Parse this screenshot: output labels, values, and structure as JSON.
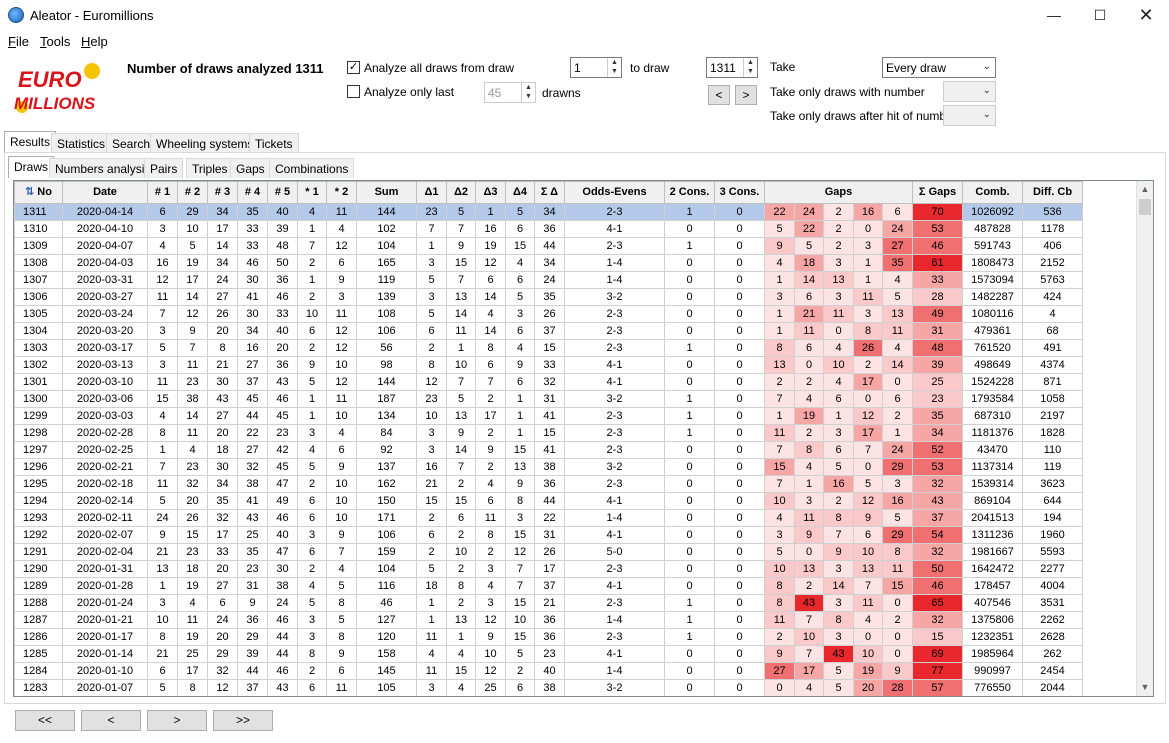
{
  "window": {
    "title": "Aleator - Euromillions"
  },
  "menu": [
    "File",
    "Tools",
    "Help"
  ],
  "controls": {
    "draws_analyzed": "Number of draws analyzed 1311",
    "analyze_all_label": "Analyze all draws from draw",
    "analyze_all_checked": "✓",
    "from_draw": "1",
    "to_draw_label": "to draw",
    "to_draw": "1311",
    "prev": "<",
    "next": ">",
    "analyze_last_label": "Analyze only last",
    "analyze_last_value": "45",
    "drawns_label": "drawns",
    "take_label": "Take",
    "take_value": "Every draw",
    "take_with_number_label": "Take only draws with number",
    "take_after_hit_label": "Take only draws after hit of number"
  },
  "logo": {
    "line1": "EURO",
    "line2": "MILLIONS"
  },
  "tabs_main": [
    "Results",
    "Statistics",
    "Search",
    "Wheeling systems",
    "Tickets"
  ],
  "tabs_sub": [
    "Draws",
    "Numbers analysis",
    "Pairs",
    "Triples",
    "Gaps",
    "Combinations"
  ],
  "grid": {
    "headers": [
      "No",
      "Date",
      "# 1",
      "# 2",
      "# 3",
      "# 4",
      "# 5",
      "* 1",
      "* 2",
      "Sum",
      "Δ1",
      "Δ2",
      "Δ3",
      "Δ4",
      "Σ Δ",
      "Odds-Evens",
      "2 Cons.",
      "3 Cons.",
      "Gaps",
      "Σ Gaps",
      "Comb.",
      "Diff. Cb"
    ],
    "rows": [
      [
        "1311",
        "2020-04-14",
        "6",
        "29",
        "34",
        "35",
        "40",
        "4",
        "11",
        "144",
        "23",
        "5",
        "1",
        "5",
        "34",
        "2-3",
        "1",
        "0",
        "22",
        "24",
        "2",
        "16",
        "6",
        "70",
        "1026092",
        "536"
      ],
      [
        "1310",
        "2020-04-10",
        "3",
        "10",
        "17",
        "33",
        "39",
        "1",
        "4",
        "102",
        "7",
        "7",
        "16",
        "6",
        "36",
        "4-1",
        "0",
        "0",
        "5",
        "22",
        "2",
        "0",
        "24",
        "53",
        "487828",
        "1178"
      ],
      [
        "1309",
        "2020-04-07",
        "4",
        "5",
        "14",
        "33",
        "48",
        "7",
        "12",
        "104",
        "1",
        "9",
        "19",
        "15",
        "44",
        "2-3",
        "1",
        "0",
        "9",
        "5",
        "2",
        "3",
        "27",
        "46",
        "591743",
        "406"
      ],
      [
        "1308",
        "2020-04-03",
        "16",
        "19",
        "34",
        "46",
        "50",
        "2",
        "6",
        "165",
        "3",
        "15",
        "12",
        "4",
        "34",
        "1-4",
        "0",
        "0",
        "4",
        "18",
        "3",
        "1",
        "35",
        "61",
        "1808473",
        "2152"
      ],
      [
        "1307",
        "2020-03-31",
        "12",
        "17",
        "24",
        "30",
        "36",
        "1",
        "9",
        "119",
        "5",
        "7",
        "6",
        "6",
        "24",
        "1-4",
        "0",
        "0",
        "1",
        "14",
        "13",
        "1",
        "4",
        "33",
        "1573094",
        "5763"
      ],
      [
        "1306",
        "2020-03-27",
        "11",
        "14",
        "27",
        "41",
        "46",
        "2",
        "3",
        "139",
        "3",
        "13",
        "14",
        "5",
        "35",
        "3-2",
        "0",
        "0",
        "3",
        "6",
        "3",
        "11",
        "5",
        "28",
        "1482287",
        "424"
      ],
      [
        "1305",
        "2020-03-24",
        "7",
        "12",
        "26",
        "30",
        "33",
        "10",
        "11",
        "108",
        "5",
        "14",
        "4",
        "3",
        "26",
        "2-3",
        "0",
        "0",
        "1",
        "21",
        "11",
        "3",
        "13",
        "49",
        "1080116",
        "4"
      ],
      [
        "1304",
        "2020-03-20",
        "3",
        "9",
        "20",
        "34",
        "40",
        "6",
        "12",
        "106",
        "6",
        "11",
        "14",
        "6",
        "37",
        "2-3",
        "0",
        "0",
        "1",
        "11",
        "0",
        "8",
        "11",
        "31",
        "479361",
        "68"
      ],
      [
        "1303",
        "2020-03-17",
        "5",
        "7",
        "8",
        "16",
        "20",
        "2",
        "12",
        "56",
        "2",
        "1",
        "8",
        "4",
        "15",
        "2-3",
        "1",
        "0",
        "8",
        "6",
        "4",
        "26",
        "4",
        "48",
        "761520",
        "491"
      ],
      [
        "1302",
        "2020-03-13",
        "3",
        "11",
        "21",
        "27",
        "36",
        "9",
        "10",
        "98",
        "8",
        "10",
        "6",
        "9",
        "33",
        "4-1",
        "0",
        "0",
        "13",
        "0",
        "10",
        "2",
        "14",
        "39",
        "498649",
        "4374"
      ],
      [
        "1301",
        "2020-03-10",
        "11",
        "23",
        "30",
        "37",
        "43",
        "5",
        "12",
        "144",
        "12",
        "7",
        "7",
        "6",
        "32",
        "4-1",
        "0",
        "0",
        "2",
        "2",
        "4",
        "17",
        "0",
        "25",
        "1524228",
        "871"
      ],
      [
        "1300",
        "2020-03-06",
        "15",
        "38",
        "43",
        "45",
        "46",
        "1",
        "11",
        "187",
        "23",
        "5",
        "2",
        "1",
        "31",
        "3-2",
        "1",
        "0",
        "7",
        "4",
        "6",
        "0",
        "6",
        "23",
        "1793584",
        "1058"
      ],
      [
        "1299",
        "2020-03-03",
        "4",
        "14",
        "27",
        "44",
        "45",
        "1",
        "10",
        "134",
        "10",
        "13",
        "17",
        "1",
        "41",
        "2-3",
        "1",
        "0",
        "1",
        "19",
        "1",
        "12",
        "2",
        "35",
        "687310",
        "2197"
      ],
      [
        "1298",
        "2020-02-28",
        "8",
        "11",
        "20",
        "22",
        "23",
        "3",
        "4",
        "84",
        "3",
        "9",
        "2",
        "1",
        "15",
        "2-3",
        "1",
        "0",
        "11",
        "2",
        "3",
        "17",
        "1",
        "34",
        "1181376",
        "1828"
      ],
      [
        "1297",
        "2020-02-25",
        "1",
        "4",
        "18",
        "27",
        "42",
        "4",
        "6",
        "92",
        "3",
        "14",
        "9",
        "15",
        "41",
        "2-3",
        "0",
        "0",
        "7",
        "8",
        "6",
        "7",
        "24",
        "52",
        "43470",
        "110"
      ],
      [
        "1296",
        "2020-02-21",
        "7",
        "23",
        "30",
        "32",
        "45",
        "5",
        "9",
        "137",
        "16",
        "7",
        "2",
        "13",
        "38",
        "3-2",
        "0",
        "0",
        "15",
        "4",
        "5",
        "0",
        "29",
        "53",
        "1137314",
        "119"
      ],
      [
        "1295",
        "2020-02-18",
        "11",
        "32",
        "34",
        "38",
        "47",
        "2",
        "10",
        "162",
        "21",
        "2",
        "4",
        "9",
        "36",
        "2-3",
        "0",
        "0",
        "7",
        "1",
        "16",
        "5",
        "3",
        "32",
        "1539314",
        "3623"
      ],
      [
        "1294",
        "2020-02-14",
        "5",
        "20",
        "35",
        "41",
        "49",
        "6",
        "10",
        "150",
        "15",
        "15",
        "6",
        "8",
        "44",
        "4-1",
        "0",
        "0",
        "10",
        "3",
        "2",
        "12",
        "16",
        "43",
        "869104",
        "644"
      ],
      [
        "1293",
        "2020-02-11",
        "24",
        "26",
        "32",
        "43",
        "46",
        "6",
        "10",
        "171",
        "2",
        "6",
        "11",
        "3",
        "22",
        "1-4",
        "0",
        "0",
        "4",
        "11",
        "8",
        "9",
        "5",
        "37",
        "2041513",
        "194"
      ],
      [
        "1292",
        "2020-02-07",
        "9",
        "15",
        "17",
        "25",
        "40",
        "3",
        "9",
        "106",
        "6",
        "2",
        "8",
        "15",
        "31",
        "4-1",
        "0",
        "0",
        "3",
        "9",
        "7",
        "6",
        "29",
        "54",
        "1311236",
        "1960"
      ],
      [
        "1291",
        "2020-02-04",
        "21",
        "23",
        "33",
        "35",
        "47",
        "6",
        "7",
        "159",
        "2",
        "10",
        "2",
        "12",
        "26",
        "5-0",
        "0",
        "0",
        "5",
        "0",
        "9",
        "10",
        "8",
        "32",
        "1981667",
        "5593"
      ],
      [
        "1290",
        "2020-01-31",
        "13",
        "18",
        "20",
        "23",
        "30",
        "2",
        "4",
        "104",
        "5",
        "2",
        "3",
        "7",
        "17",
        "2-3",
        "0",
        "0",
        "10",
        "13",
        "3",
        "13",
        "11",
        "50",
        "1642472",
        "2277"
      ],
      [
        "1289",
        "2020-01-28",
        "1",
        "19",
        "27",
        "31",
        "38",
        "4",
        "5",
        "116",
        "18",
        "8",
        "4",
        "7",
        "37",
        "4-1",
        "0",
        "0",
        "8",
        "2",
        "14",
        "7",
        "15",
        "46",
        "178457",
        "4004"
      ],
      [
        "1288",
        "2020-01-24",
        "3",
        "4",
        "6",
        "9",
        "24",
        "5",
        "8",
        "46",
        "1",
        "2",
        "3",
        "15",
        "21",
        "2-3",
        "1",
        "0",
        "8",
        "43",
        "3",
        "11",
        "0",
        "65",
        "407546",
        "3531"
      ],
      [
        "1287",
        "2020-01-21",
        "10",
        "11",
        "24",
        "36",
        "46",
        "3",
        "5",
        "127",
        "1",
        "13",
        "12",
        "10",
        "36",
        "1-4",
        "1",
        "0",
        "11",
        "7",
        "8",
        "4",
        "2",
        "32",
        "1375806",
        "2262"
      ],
      [
        "1286",
        "2020-01-17",
        "8",
        "19",
        "20",
        "29",
        "44",
        "3",
        "8",
        "120",
        "11",
        "1",
        "9",
        "15",
        "36",
        "2-3",
        "1",
        "0",
        "2",
        "10",
        "3",
        "0",
        "0",
        "15",
        "1232351",
        "2628"
      ],
      [
        "1285",
        "2020-01-14",
        "21",
        "25",
        "29",
        "39",
        "44",
        "8",
        "9",
        "158",
        "4",
        "4",
        "10",
        "5",
        "23",
        "4-1",
        "0",
        "0",
        "9",
        "7",
        "43",
        "10",
        "0",
        "69",
        "1985964",
        "262"
      ],
      [
        "1284",
        "2020-01-10",
        "6",
        "17",
        "32",
        "44",
        "46",
        "2",
        "6",
        "145",
        "11",
        "15",
        "12",
        "2",
        "40",
        "1-4",
        "0",
        "0",
        "27",
        "17",
        "5",
        "19",
        "9",
        "77",
        "990997",
        "2454"
      ],
      [
        "1283",
        "2020-01-07",
        "5",
        "8",
        "12",
        "37",
        "43",
        "6",
        "11",
        "105",
        "3",
        "4",
        "25",
        "6",
        "38",
        "3-2",
        "0",
        "0",
        "0",
        "4",
        "5",
        "20",
        "28",
        "57",
        "776550",
        "2044"
      ]
    ]
  },
  "nav": [
    "<<",
    "<",
    ">",
    ">>"
  ]
}
